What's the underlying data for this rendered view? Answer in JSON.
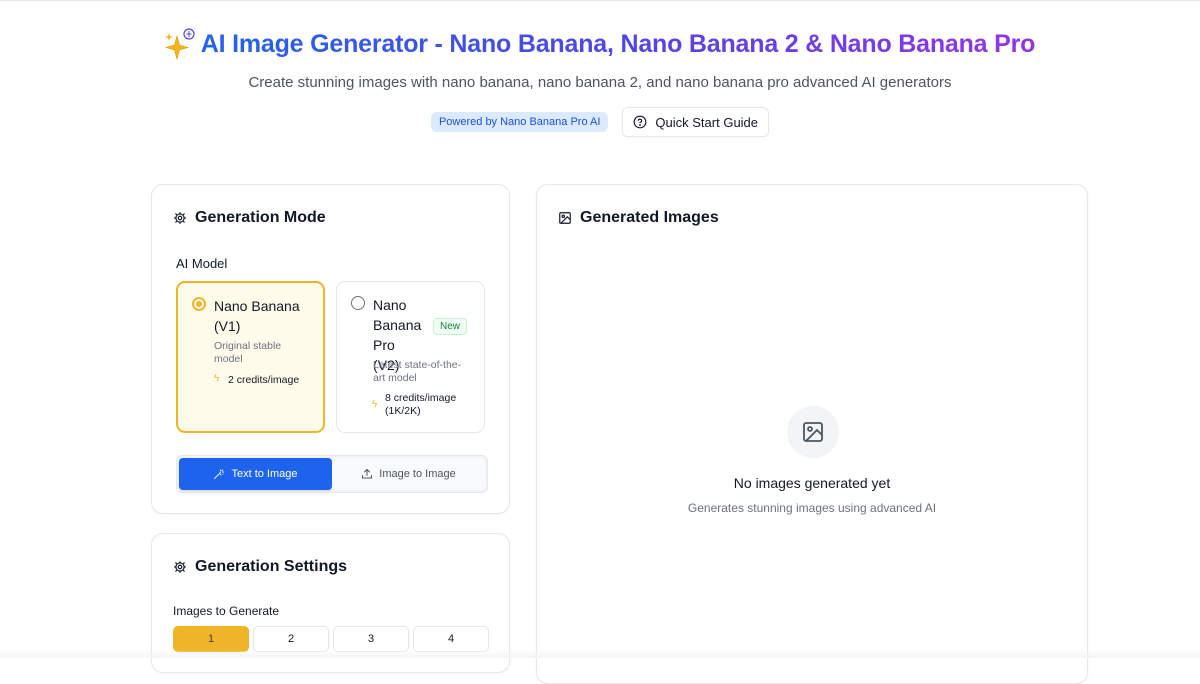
{
  "header": {
    "title": "AI Image Generator - Nano Banana, Nano Banana 2 & Nano Banana Pro",
    "subtitle": "Create stunning images with nano banana, nano banana 2, and nano banana pro advanced AI generators",
    "badge": "Powered by Nano Banana Pro AI",
    "guide_button": "Quick Start Guide",
    "icon": "sparkles-icon"
  },
  "generation_mode": {
    "title": "Generation Mode",
    "model_label": "AI Model",
    "models": [
      {
        "name": "Nano Banana (V1)",
        "description": "Original stable model",
        "credits": "2 credits/image",
        "selected": true
      },
      {
        "name": "Nano Banana Pro (V2)",
        "badge": "New",
        "description": "Latest state-of-the-art model",
        "credits": "8 credits/image (1K/2K)",
        "selected": false
      }
    ],
    "tabs": [
      {
        "label": "Text to Image",
        "icon": "magic-wand-icon",
        "active": true
      },
      {
        "label": "Image to Image",
        "icon": "upload-icon",
        "active": false
      }
    ]
  },
  "generation_settings": {
    "title": "Generation Settings",
    "count_label": "Images to Generate",
    "counts": [
      "1",
      "2",
      "3",
      "4"
    ],
    "selected_count": "1"
  },
  "generated_images": {
    "title": "Generated Images",
    "empty_title": "No images generated yet",
    "empty_subtitle": "Generates stunning images using advanced AI"
  },
  "colors": {
    "accent_yellow": "#f0b429",
    "primary_blue": "#1d63ed",
    "title_gradient_start": "#2563eb",
    "title_gradient_end": "#9333ea"
  }
}
